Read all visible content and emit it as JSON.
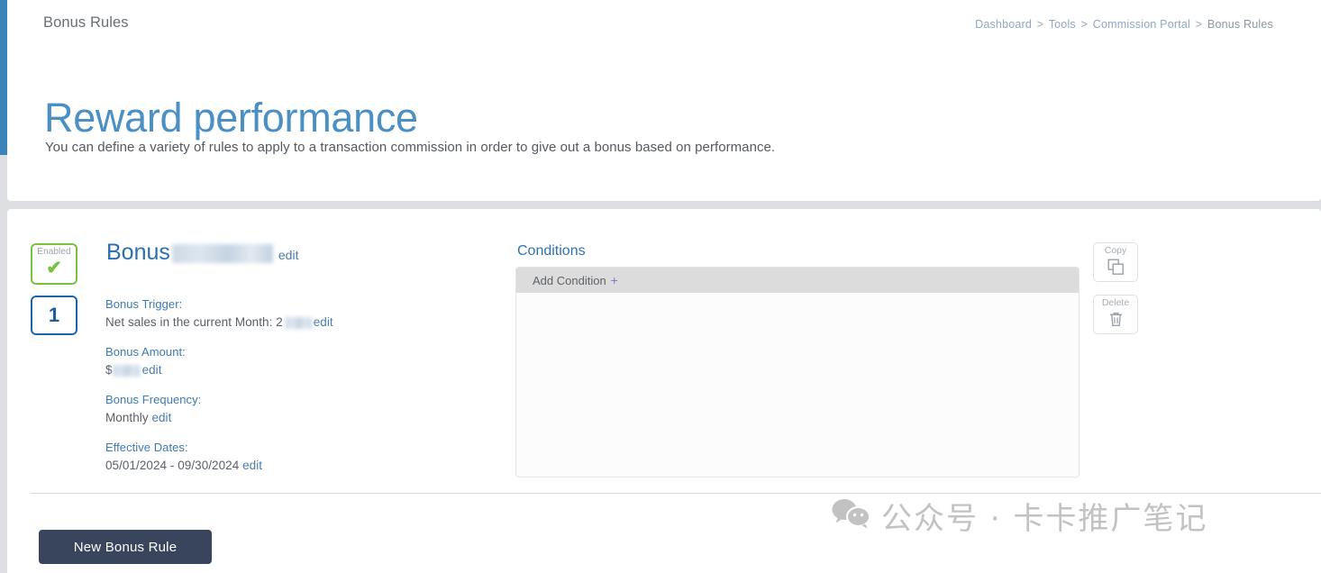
{
  "header": {
    "kicker": "Bonus Rules",
    "title": "Reward performance",
    "subtitle": "You can define a variety of rules to apply to a transaction commission in order to give out a bonus based on performance.",
    "breadcrumb": {
      "items": [
        "Dashboard",
        "Tools",
        "Commission Portal",
        "Bonus Rules"
      ],
      "separator": ">"
    }
  },
  "rule": {
    "enabled_badge": {
      "caption": "Enabled",
      "icon": "check-icon",
      "check_glyph": "✔"
    },
    "number_badge": "1",
    "title_prefix": "Bonus",
    "title_edit_label": "edit",
    "fields": [
      {
        "label": "Bonus Trigger:",
        "value_prefix": "Net sales in the current Month: 2",
        "value_suffix": "",
        "edit_label": "edit",
        "redacted": true
      },
      {
        "label": "Bonus Amount:",
        "value_prefix": "$",
        "value_suffix": "",
        "edit_label": "edit",
        "redacted": true
      },
      {
        "label": "Bonus Frequency:",
        "value_prefix": "Monthly",
        "value_suffix": "",
        "edit_label": "edit",
        "redacted": false
      },
      {
        "label": "Effective Dates:",
        "value_prefix": "05/01/2024 - 09/30/2024",
        "value_suffix": "",
        "edit_label": "edit",
        "redacted": false
      }
    ],
    "conditions": {
      "title": "Conditions",
      "add_label": "Add Condition",
      "add_plus": "+",
      "items": []
    },
    "actions": [
      {
        "label": "Copy",
        "icon": "copy-icon"
      },
      {
        "label": "Delete",
        "icon": "trash-icon"
      }
    ]
  },
  "footer": {
    "new_rule_label": "New Bonus Rule"
  },
  "watermark": {
    "icon": "wechat-icon",
    "text": "公众号 · 卡卡推广笔记"
  },
  "colors": {
    "accent_blue": "#3b84b8",
    "title_blue": "#4a90c4",
    "enabled_green": "#7ac143",
    "number_blue": "#1b66a8",
    "button_navy": "#38455c",
    "page_bg": "#dcdee2"
  }
}
